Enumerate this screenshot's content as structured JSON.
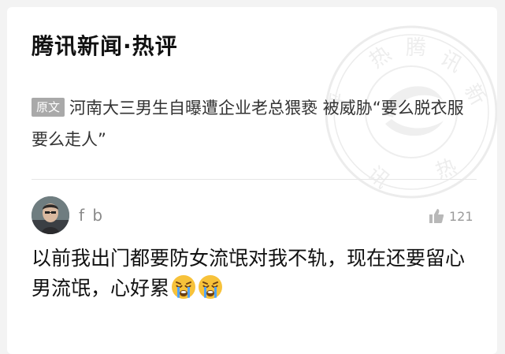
{
  "header": {
    "title": "腾讯新闻·热评"
  },
  "source": {
    "tag": "原文",
    "text": "河南大三男生自曝遭企业老总猥亵 被威胁“要么脱衣服要么走人”"
  },
  "comment": {
    "username": "f b",
    "likes": "121",
    "text": "以前我出门都要防女流氓对我不轨，现在还要留心男流氓，心好累",
    "emojis": [
      "crying-face-icon",
      "crying-face-icon"
    ]
  },
  "watermark": {
    "text": "腾讯新闻热评"
  },
  "colors": {
    "background": "#f3f3f3",
    "card": "#ffffff",
    "tag": "#a9a9a9",
    "muted": "#8a8a8a"
  }
}
